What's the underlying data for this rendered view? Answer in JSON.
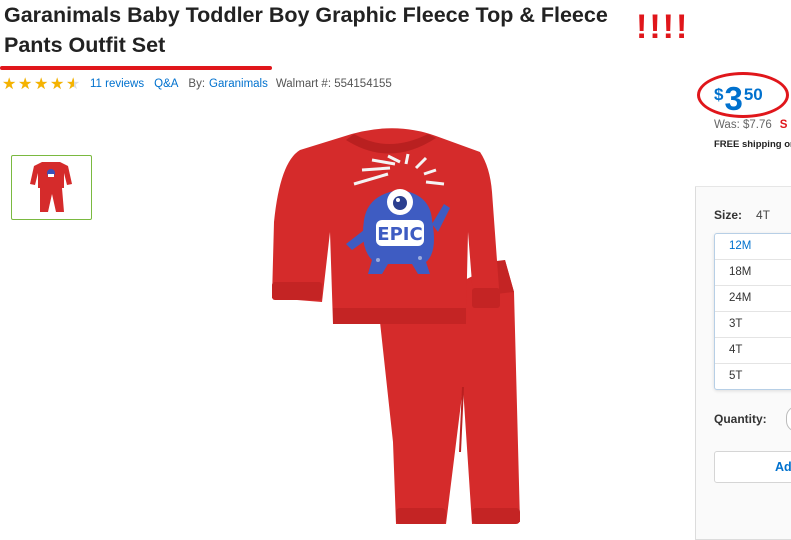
{
  "product": {
    "title": "Garanimals Baby Toddler Boy Graphic Fleece Top & Fleece Pants Outfit Set",
    "annotation": "!!!!",
    "rating_fraction": 0.9,
    "reviews_label": "11 reviews",
    "qa_label": "Q&A",
    "by_label": "By:",
    "brand": "Garanimals",
    "item_number": "Walmart #: 554154155",
    "graphic_text": "EPIC"
  },
  "price": {
    "currency": "$",
    "dollars": "3",
    "cents": "50",
    "was": "Was: $7.76",
    "save": "S",
    "shipping": "FREE shipping on"
  },
  "size": {
    "label": "Size:",
    "selected": "4T",
    "options": [
      "12M",
      "18M",
      "24M",
      "3T",
      "4T",
      "5T"
    ]
  },
  "quantity": {
    "label": "Quantity:"
  },
  "cart": {
    "add_label": "Ad"
  },
  "colors": {
    "accent": "#0071ce",
    "annotation_red": "#e0161b",
    "garment_red": "#d52b2b",
    "star": "#f5b301"
  }
}
